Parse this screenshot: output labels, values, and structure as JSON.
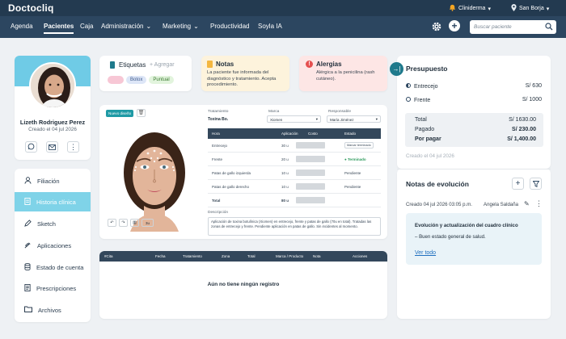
{
  "app": {
    "title": "Doctocliq"
  },
  "topbar": {
    "clinic": "Cliniderma",
    "location": "San Borja"
  },
  "nav": {
    "items": [
      "Agenda",
      "Pacientes",
      "Caja",
      "Administración",
      "Marketing",
      "Productividad",
      "Soyla IA"
    ],
    "search_placeholder": "Buscar paciente"
  },
  "patient": {
    "name": "Lizeth Rodriguez Perez",
    "created": "Creado el 04 jul 2026"
  },
  "sidebar": {
    "items": [
      "Filiación",
      "Historia clínica",
      "Sketch",
      "Aplicaciones",
      "Estado de cuenta",
      "Prescripciones",
      "Archivos"
    ]
  },
  "labels": {
    "title": "Etiquetas",
    "add": "+ Agregar",
    "chips": [
      "",
      "Botox",
      "Puntual"
    ]
  },
  "notes": {
    "title": "Notas",
    "text": "La paciente fue informada del diagnóstico y tratamiento. Acepta procedimiento."
  },
  "allergies": {
    "title": "Alergias",
    "text": "Alérgica a la penicilina (rash cutáneo)."
  },
  "design": {
    "new_button": "Nuevo diseño",
    "treatment_label": "Tratamiento",
    "treatment_value": "Toxina Bo.",
    "brand_label": "Marca",
    "brand_value": "Xiomen",
    "responsible_label": "Responsable",
    "responsible_value": "María Jiménez",
    "headers": [
      "Hora",
      "Aplicación",
      "Costo",
      "Estado"
    ],
    "rows": [
      {
        "zone": "Entrecejo",
        "amount": "30 u",
        "status": "Marcar terminado"
      },
      {
        "zone": "Frente",
        "amount": "20 u",
        "status": "Terminado"
      },
      {
        "zone": "Patas de gallo izquierda",
        "amount": "10 u",
        "status": "Pendiente"
      },
      {
        "zone": "Patas de gallo derecho",
        "amount": "10 u",
        "status": "Pendiente"
      }
    ],
    "total_label": "Total",
    "total_value": "80 u",
    "description_label": "Descripción",
    "description": "Aplicación de toxina botulínica (Xiomen) en entrecejo, frente y patas de gallo (70u en total). Tratadas las zonas de entrecejo y frente. Pendiente aplicación en patas de gallo. Sin incidentes al momento.",
    "tool_count": "3u"
  },
  "records": {
    "headers": [
      "#Cita",
      "Fecha",
      "Tratamiento",
      "Zona",
      "Total",
      "Marca / Producto",
      "Nota",
      "Acciones"
    ],
    "empty": "Aún no tiene ningún registro"
  },
  "budget": {
    "title": "Presupuesto",
    "items": [
      {
        "label": "Entrecejo",
        "value": "S/ 630"
      },
      {
        "label": "Frente",
        "value": "S/ 1000"
      }
    ],
    "total_label": "Total",
    "total_value": "S/ 1630.00",
    "paid_label": "Pagado",
    "paid_value": "S/ 230.00",
    "due_label": "Por pagar",
    "due_value": "S/ 1,400.00",
    "created": "Creado el 04 jul 2026"
  },
  "evolution": {
    "title": "Notas de evolución",
    "entry_date": "Creado 04 jul 2026 03:05 p.m.",
    "entry_author": "Angela Saldaña",
    "entry_title": "Evolución y actualización del cuadro clínico",
    "entry_text": "– Buen estado general de salud.",
    "link": "Ver todo"
  },
  "colors": {
    "topbar": "#233a50",
    "navbar": "#2c4660",
    "accent": "#7fd3e8",
    "link": "#1f6fbf",
    "success": "#2e9b5e"
  }
}
